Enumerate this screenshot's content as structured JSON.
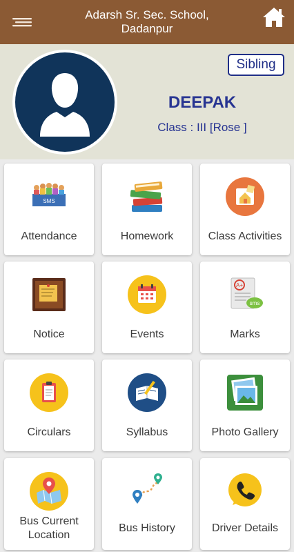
{
  "header": {
    "title_line1": "Adarsh Sr. Sec. School,",
    "title_line2": "Dadanpur",
    "menu_icon": "hamburger-menu-icon",
    "home_icon": "home-icon",
    "bg_color": "#8b5a34"
  },
  "profile": {
    "sibling_label": "Sibling",
    "name": "DEEPAK",
    "class_text": "Class : III [Rose ]",
    "avatar_color": "#10345a",
    "text_color": "#273492"
  },
  "tiles": [
    {
      "label": "Attendance",
      "icon": "attendance-group-icon"
    },
    {
      "label": "Homework",
      "icon": "books-stack-icon"
    },
    {
      "label": "Class Activities",
      "icon": "class-activities-icon"
    },
    {
      "label": "Notice",
      "icon": "notice-board-icon"
    },
    {
      "label": "Events",
      "icon": "calendar-icon"
    },
    {
      "label": "Marks",
      "icon": "marks-report-icon"
    },
    {
      "label": "Circulars",
      "icon": "clipboard-icon"
    },
    {
      "label": "Syllabus",
      "icon": "syllabus-book-icon"
    },
    {
      "label": "Photo Gallery",
      "icon": "photo-gallery-icon"
    },
    {
      "label": "Bus Current Location",
      "icon": "map-location-icon"
    },
    {
      "label": "Bus History",
      "icon": "route-history-icon"
    },
    {
      "label": "Driver Details",
      "icon": "phone-icon"
    }
  ]
}
